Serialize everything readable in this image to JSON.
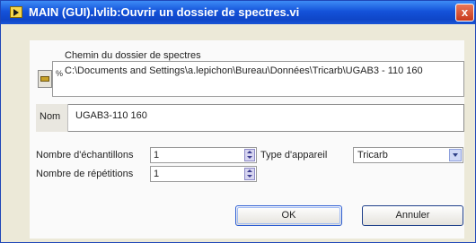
{
  "window": {
    "title": "MAIN (GUI).lvlib:Ouvrir un dossier de spectres.vi",
    "close": "x"
  },
  "path_section": {
    "label": "Chemin du dossier de spectres",
    "path_value": "C:\\Documents and Settings\\a.lepichon\\Bureau\\Données\\Tricarb\\UGAB3 - 110 160",
    "path_icon": "%"
  },
  "name_field": {
    "label": "Nom",
    "value": "UGAB3-110 160"
  },
  "samples": {
    "label": "Nombre d'échantillons",
    "value": "1"
  },
  "repetitions": {
    "label": "Nombre de répétitions",
    "value": "1"
  },
  "device_type": {
    "label": "Type d'appareil",
    "value": "Tricarb"
  },
  "buttons": {
    "ok": "OK",
    "cancel": "Annuler"
  }
}
